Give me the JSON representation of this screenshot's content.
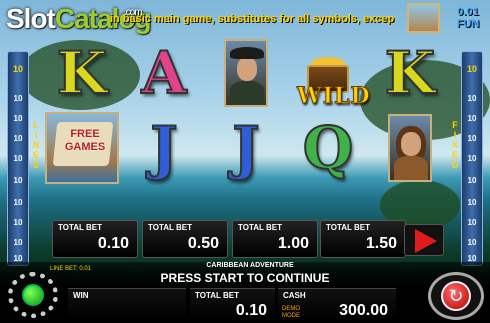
{
  "header": {
    "logo_main": "Slot",
    "logo_accent": "Catalog",
    "logo_suffix": ".com",
    "ticker": "in basic main game, substitutes for all symbols, except",
    "fun_value": "0.01",
    "fun_label": "FUN"
  },
  "side_left": {
    "numbers": [
      "10",
      "10",
      "10",
      "10",
      "10",
      "10",
      "10",
      "10",
      "10",
      "10"
    ],
    "label": "LINES"
  },
  "side_right": {
    "numbers": [
      "10",
      "10",
      "10",
      "10",
      "10",
      "10",
      "10",
      "10",
      "10",
      "10"
    ],
    "label": "FIXED"
  },
  "reels": {
    "row1": [
      "K",
      "A",
      "pirate-captain",
      "treasure-chest-wild",
      "K"
    ],
    "wild_text": "WILD",
    "free_games_text": "FREE GAMES",
    "row2": [
      "free-games-ship",
      "J",
      "J",
      "Q",
      "lady-portrait"
    ]
  },
  "bet_options": [
    {
      "label": "TOTAL BET",
      "value": "0.10"
    },
    {
      "label": "TOTAL BET",
      "value": "0.50"
    },
    {
      "label": "TOTAL BET",
      "value": "1.00"
    },
    {
      "label": "TOTAL BET",
      "value": "1.50"
    }
  ],
  "footer": {
    "line_bet": "LINE BET: 0.01",
    "game_title": "CARIBBEAN ADVENTURE",
    "status": "PRESS START TO CONTINUE",
    "win_label": "WIN",
    "win_value": "",
    "total_bet_label": "TOTAL BET",
    "total_bet_value": "0.10",
    "cash_label": "CASH",
    "cash_value": "300.00",
    "demo_text": "DEMO MODE"
  },
  "colors": {
    "accent_yellow": "#ffd200",
    "play_red": "#e01b1b",
    "settings_green": "#12a10e",
    "fun_blue": "#3fa9ff"
  }
}
